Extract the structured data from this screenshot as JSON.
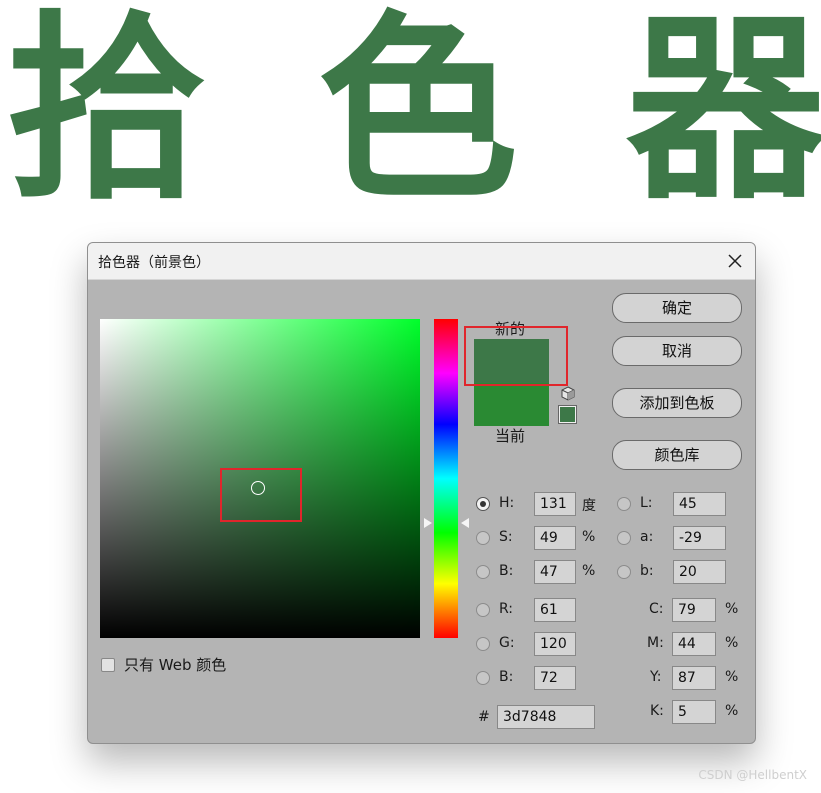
{
  "hero": {
    "chars": [
      "拾",
      "色",
      "器"
    ],
    "color": "#3d7848"
  },
  "dialog": {
    "title": "拾色器（前景色）",
    "close_icon": "close-icon"
  },
  "swatches": {
    "new_label": "新的",
    "current_label": "当前",
    "new_color": "#3d7848",
    "current_color": "#2a8a33",
    "gamut_icon": "cube-icon"
  },
  "buttons": {
    "ok": "确定",
    "cancel": "取消",
    "add_to_swatches": "添加到色板",
    "color_libraries": "颜色库"
  },
  "web_only": {
    "label": "只有 Web 颜色",
    "checked": false
  },
  "fields": {
    "H": {
      "label": "H:",
      "value": "131",
      "unit": "度",
      "selected": true
    },
    "S": {
      "label": "S:",
      "value": "49",
      "unit": "%"
    },
    "Bv": {
      "label": "B:",
      "value": "47",
      "unit": "%"
    },
    "R": {
      "label": "R:",
      "value": "61"
    },
    "G": {
      "label": "G:",
      "value": "120"
    },
    "B": {
      "label": "B:",
      "value": "72"
    },
    "L": {
      "label": "L:",
      "value": "45"
    },
    "a": {
      "label": "a:",
      "value": "-29"
    },
    "b": {
      "label": "b:",
      "value": "20"
    },
    "C": {
      "label": "C:",
      "value": "79",
      "unit": "%"
    },
    "M": {
      "label": "M:",
      "value": "44",
      "unit": "%"
    },
    "Y": {
      "label": "Y:",
      "value": "87",
      "unit": "%"
    },
    "K": {
      "label": "K:",
      "value": "5",
      "unit": "%"
    }
  },
  "hex": {
    "label": "#",
    "value": "3d7848"
  },
  "watermark": "CSDN @HellbentX"
}
